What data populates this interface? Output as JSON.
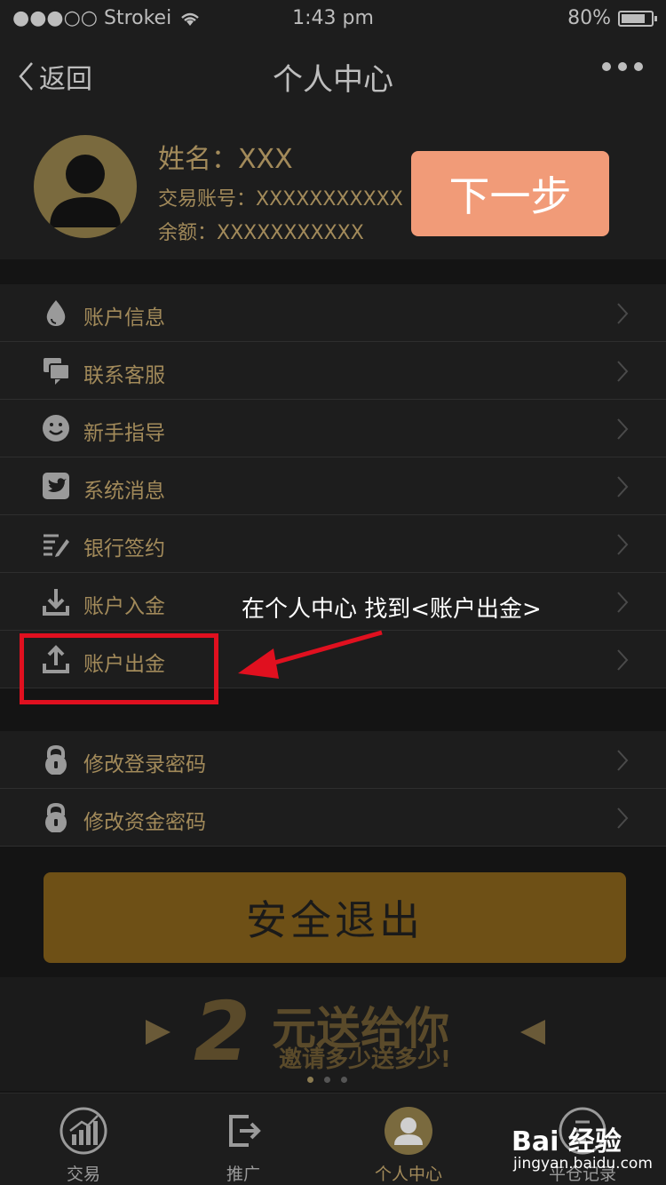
{
  "status_bar": {
    "carrier": "●●●○○ Strokei",
    "time": "1:43 pm",
    "battery": "80%",
    "battery_level": 0.8
  },
  "nav": {
    "back_label": "返回",
    "title": "个人中心"
  },
  "profile": {
    "name": "姓名：XXX",
    "account": "交易账号：XXXXXXXXXXX",
    "balance": "余额：XXXXXXXXXXX"
  },
  "next_step": "下一步",
  "menu_group_1": [
    {
      "label": "账户信息",
      "icon": "drop-icon"
    },
    {
      "label": "联系客服",
      "icon": "chat-icon"
    },
    {
      "label": "新手指导",
      "icon": "smiley-icon"
    },
    {
      "label": "系统消息",
      "icon": "bird-icon"
    },
    {
      "label": "银行签约",
      "icon": "sign-icon"
    },
    {
      "label": "账户入金",
      "icon": "download-icon"
    },
    {
      "label": "账户出金",
      "icon": "upload-icon"
    }
  ],
  "menu_group_2": [
    {
      "label": "修改登录密码",
      "icon": "lock-icon"
    },
    {
      "label": "修改资金密码",
      "icon": "lock-icon"
    }
  ],
  "annotation": "在个人中心 找到<账户出金>",
  "logout": "安全退出",
  "banner": {
    "big_number": "2",
    "headline": "元送给你",
    "sub": "邀请多少送多少!"
  },
  "tabs": [
    {
      "label": "交易",
      "icon": "chart-icon"
    },
    {
      "label": "推广",
      "icon": "exit-icon"
    },
    {
      "label": "个人中心",
      "icon": "user-icon"
    },
    {
      "label": "平仓记录",
      "icon": "record-icon"
    }
  ],
  "watermark": {
    "brand": "Bai 经验",
    "site": "jingyan.baidu.com"
  },
  "colors": {
    "background": "#141414",
    "panel": "#1d1d1d",
    "gold_text": "#a28a5a",
    "next_button": "#f19b78",
    "logout_button": "#6e5016",
    "highlight": "#e0101f"
  }
}
